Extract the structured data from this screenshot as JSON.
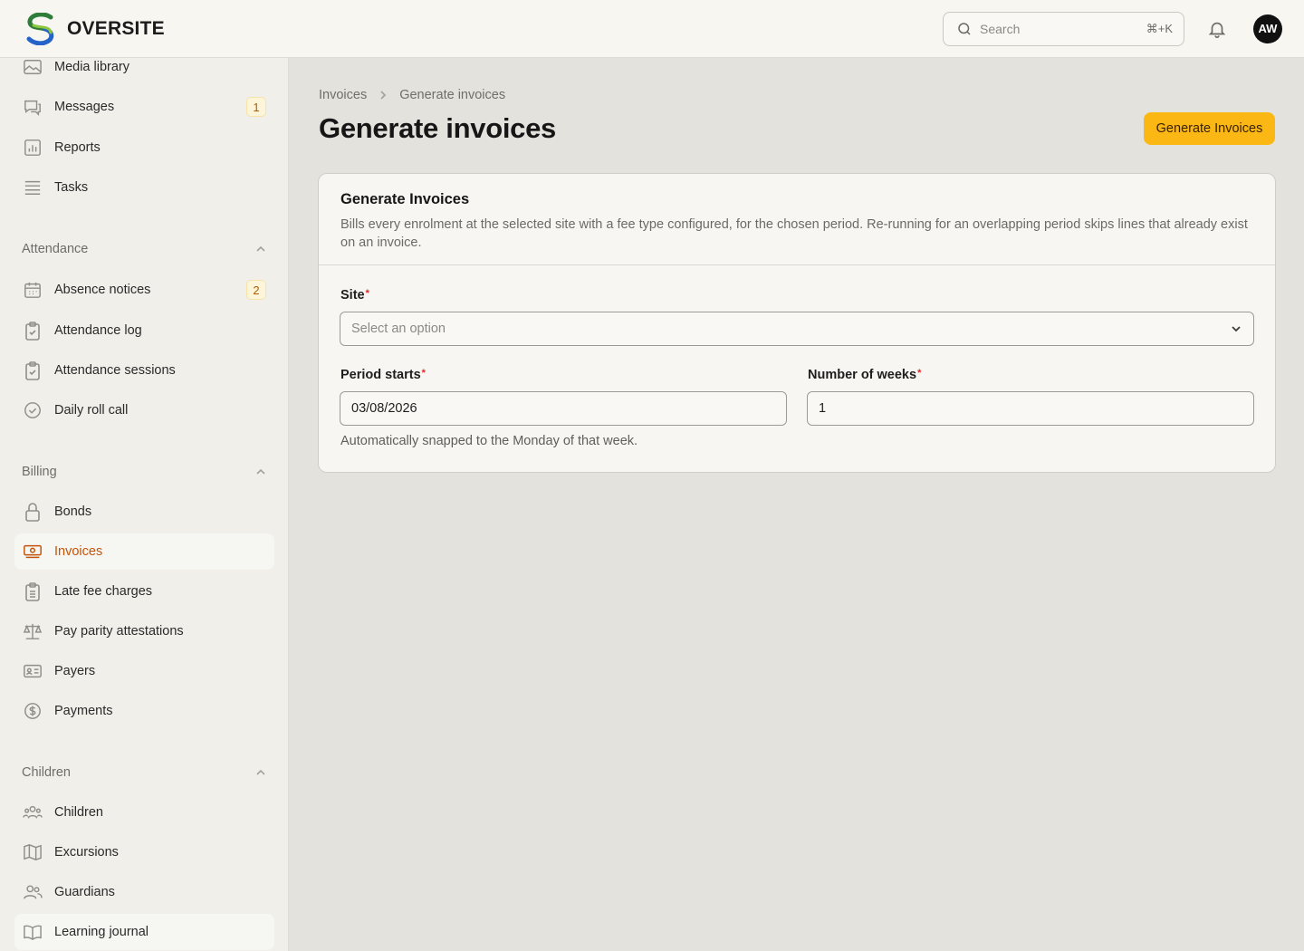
{
  "brand": {
    "name": "OVERSITE"
  },
  "topbar": {
    "search_placeholder": "Search",
    "search_shortcut": "⌘+K",
    "avatar_initials": "AW"
  },
  "sidebar": {
    "top_items": [
      {
        "label": "Media library",
        "icon": "image-icon"
      },
      {
        "label": "Messages",
        "icon": "chat-icon",
        "badge": "1"
      },
      {
        "label": "Reports",
        "icon": "bar-chart-icon"
      },
      {
        "label": "Tasks",
        "icon": "list-icon"
      }
    ],
    "groups": [
      {
        "title": "Attendance",
        "items": [
          {
            "label": "Absence notices",
            "icon": "calendar-icon",
            "badge": "2"
          },
          {
            "label": "Attendance log",
            "icon": "clipboard-check-icon"
          },
          {
            "label": "Attendance sessions",
            "icon": "clipboard-check-icon"
          },
          {
            "label": "Daily roll call",
            "icon": "check-circle-icon"
          }
        ]
      },
      {
        "title": "Billing",
        "items": [
          {
            "label": "Bonds",
            "icon": "lock-icon"
          },
          {
            "label": "Invoices",
            "icon": "banknote-icon",
            "active": true
          },
          {
            "label": "Late fee charges",
            "icon": "clipboard-list-icon"
          },
          {
            "label": "Pay parity attestations",
            "icon": "scale-icon"
          },
          {
            "label": "Payers",
            "icon": "id-card-icon"
          },
          {
            "label": "Payments",
            "icon": "dollar-circle-icon"
          }
        ]
      },
      {
        "title": "Children",
        "items": [
          {
            "label": "Children",
            "icon": "users-group-icon"
          },
          {
            "label": "Excursions",
            "icon": "map-icon"
          },
          {
            "label": "Guardians",
            "icon": "users-icon"
          },
          {
            "label": "Learning journal",
            "icon": "book-open-icon"
          }
        ]
      }
    ]
  },
  "breadcrumb": {
    "parent": "Invoices",
    "current": "Generate invoices"
  },
  "page": {
    "title": "Generate invoices",
    "primary_action": "Generate Invoices"
  },
  "form": {
    "title": "Generate Invoices",
    "description": "Bills every enrolment at the selected site with a fee type configured, for the chosen period. Re-running for an overlapping period skips lines that already exist on an invoice.",
    "site": {
      "label": "Site",
      "placeholder": "Select an option"
    },
    "period_starts": {
      "label": "Period starts",
      "value": "03/08/2026",
      "hint": "Automatically snapped to the Monday of that week."
    },
    "weeks": {
      "label": "Number of weeks",
      "value": "1"
    },
    "required_marker": "*"
  },
  "colors": {
    "accent": "#fbb714",
    "active_text": "#c2550a",
    "required": "#d92b2b"
  }
}
